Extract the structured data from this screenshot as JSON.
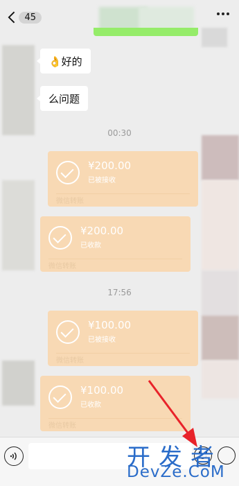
{
  "header": {
    "unread_count": "45"
  },
  "messages": {
    "m1_text": "👌好的",
    "m2_text": "么问题"
  },
  "timestamps": {
    "t1": "00:30",
    "t2": "17:56"
  },
  "transfers": [
    {
      "amount": "¥200.00",
      "status": "已被接收",
      "footer": "微信转账"
    },
    {
      "amount": "¥200.00",
      "status": "已收款",
      "footer": "微信转账"
    },
    {
      "amount": "¥100.00",
      "status": "已被接收",
      "footer": "微信转账"
    },
    {
      "amount": "¥100.00",
      "status": "已收款",
      "footer": "微信转账"
    }
  ],
  "watermark": {
    "line1": "开发者",
    "line2": "DevZe.CoM"
  },
  "colors": {
    "transfer_bg": "#f8d9b4",
    "arrow": "#e8232a",
    "sent_bubble": "#95ec69",
    "watermark": "#2a6cc9"
  }
}
